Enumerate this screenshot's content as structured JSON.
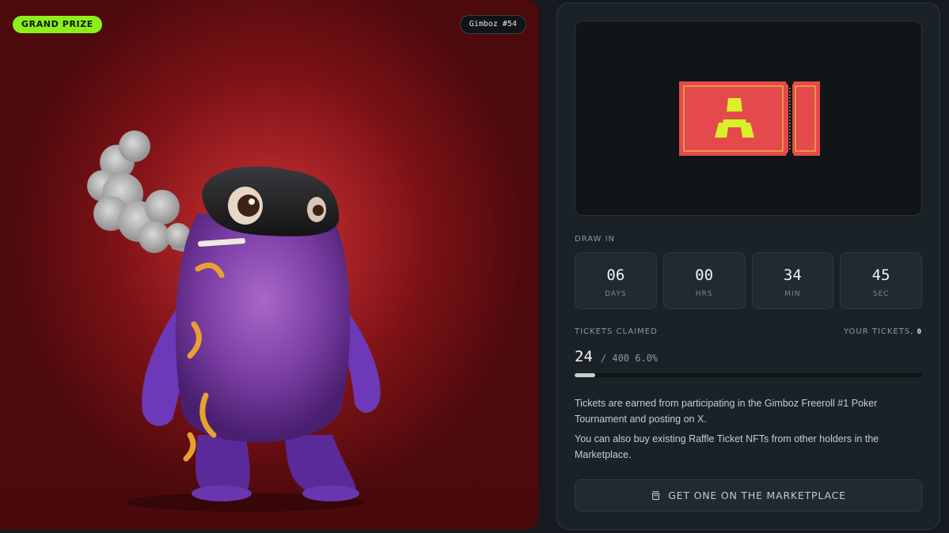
{
  "prize": {
    "badge_label": "GRAND PRIZE",
    "nft_id": "Gimboz #54",
    "image_subject": "purple-masked-creature-smoking"
  },
  "raffle": {
    "ticket_icon": "raffle-ticket-icon",
    "draw_label": "DRAW IN",
    "countdown": [
      {
        "value": "06",
        "unit": "DAYS"
      },
      {
        "value": "00",
        "unit": "HRS"
      },
      {
        "value": "34",
        "unit": "MIN"
      },
      {
        "value": "45",
        "unit": "SEC"
      }
    ],
    "tickets_label": "TICKETS CLAIMED",
    "your_tickets_label": "YOUR TICKETS,",
    "your_tickets_count": "0",
    "claimed": "24",
    "claimed_rest": "/ 400 6.0%",
    "progress_percent": 6.0,
    "description_1": "Tickets are earned from participating in the Gimboz Freeroll #1 Poker Tournament and posting on X.",
    "description_2": "You can also buy existing Raffle Ticket NFTs from other holders in the Marketplace.",
    "marketplace_button": "GET ONE ON THE MARKETPLACE",
    "button_icon": "shopping-bag-icon"
  },
  "colors": {
    "accent_green": "#8bf01a",
    "ticket_red": "#e44a4c",
    "ticket_yellow": "#d8ef2a",
    "panel_bg": "#1a2227"
  }
}
